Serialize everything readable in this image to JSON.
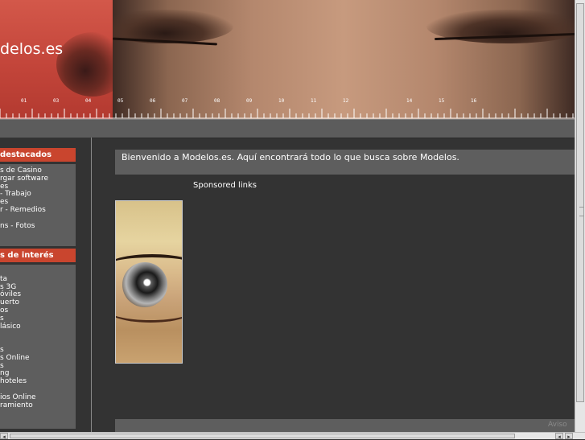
{
  "header": {
    "logo_text": "delos.es",
    "ruler_numbers": [
      "01",
      "03",
      "04",
      "05",
      "06",
      "07",
      "08",
      "09",
      "10",
      "11",
      "12",
      "14",
      "15",
      "16"
    ]
  },
  "sidebar": {
    "destacados": {
      "title": " destacados",
      "items": [
        "s de Casino",
        "rgar software",
        "es",
        "- Trabajo",
        "es",
        "r - Remedios",
        "",
        "ns - Fotos"
      ]
    },
    "interes": {
      "title": "s de interés",
      "items": [
        "",
        "ta",
        "s 3G",
        "óviles",
        "uerto",
        "os",
        "s",
        "lásico",
        "",
        "",
        "s",
        "s Online",
        "s",
        "ng",
        "hoteles",
        "",
        "ios Online",
        "ramiento"
      ]
    }
  },
  "main": {
    "welcome_text": "Bienvenido a Modelos.es. Aquí encontrará todo lo que busca sobre Modelos.",
    "sponsored_label": "Sponsored links",
    "footer_aviso": "Aviso"
  },
  "colors": {
    "accent": "#c9452e",
    "background": "#333333",
    "panel": "#5e5e5e"
  },
  "icons": {
    "scroll_left": "◂",
    "scroll_right": "▸"
  }
}
